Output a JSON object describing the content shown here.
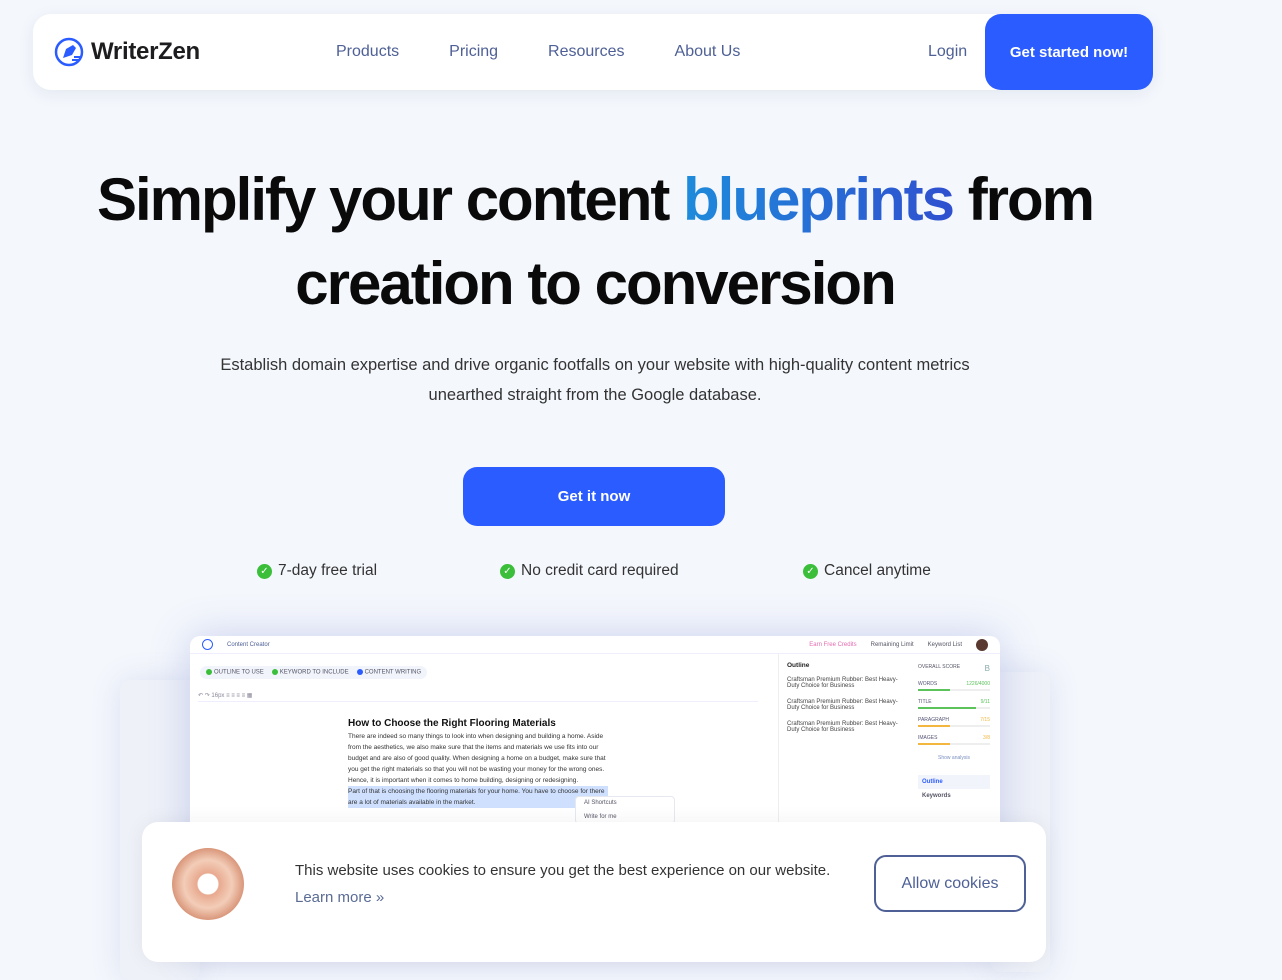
{
  "nav": {
    "brand": "WriterZen",
    "links": [
      "Products",
      "Pricing",
      "Resources",
      "About Us"
    ],
    "login": "Login",
    "cta": "Get started now!"
  },
  "hero": {
    "title_pre": "Simplify your content ",
    "title_accent": "blueprints",
    "title_post": " from",
    "title_line2": "creation to conversion",
    "subtitle_line1": "Establish domain expertise and drive organic footfalls on your website with high-quality content metrics",
    "subtitle_line2": "unearthed straight from the Google database.",
    "button": "Get it now",
    "checks": [
      "7-day free trial",
      "No credit card required",
      "Cancel anytime"
    ]
  },
  "mockup": {
    "app": "Content Creator",
    "credits": "Earn Free Credits",
    "limit": "Remaining Limit",
    "keyword_list": "Keyword List",
    "steps": [
      "OUTLINE TO USE",
      "KEYWORD TO INCLUDE",
      "CONTENT WRITING"
    ],
    "doc_title": "How to Choose the Right Flooring Materials",
    "doc_text": "There are indeed so many things to look into when designing and building a home. Aside from the aesthetics, we also make sure that the items and materials we use fits into our budget and are also of good quality. When designing a home on a budget, make sure that you get the right materials so that you will not be wasting your money for the wrong ones. Hence, it is important when it comes to home building, designing or redesigning.",
    "doc_highlight": "Part of that is choosing the flooring materials for your home. You have to choose for there are a lot of materials available in the market.",
    "ai_shortcuts": "AI Shortcuts",
    "write_for_me": "Write for me",
    "outline_title": "Outline",
    "outline_items": [
      "Craftsman Premium Rubber: Best Heavy-Duty Choice for Business",
      "Craftsman Premium Rubber: Best Heavy-Duty Choice for Business",
      "Craftsman Premium Rubber: Best Heavy-Duty Choice for Business"
    ],
    "score_title": "OVERALL SCORE",
    "grade": "B",
    "metrics": [
      {
        "label": "WORDS",
        "value": "1226/4000",
        "pct": 45,
        "color": "#5cc35c"
      },
      {
        "label": "TITLE",
        "value": "9/11",
        "pct": 80,
        "color": "#5cc35c"
      },
      {
        "label": "PARAGRAPH",
        "value": "7/15",
        "pct": 45,
        "color": "#f3b63f"
      },
      {
        "label": "IMAGES",
        "value": "3/8",
        "pct": 45,
        "color": "#f3b63f"
      }
    ],
    "show_analysis": "Show analysis",
    "tabs": [
      "Outline",
      "Keywords"
    ]
  },
  "cookie": {
    "text": "This website uses cookies to ensure you get the best experience on our website.",
    "learn_more": "Learn more »",
    "allow": "Allow cookies"
  }
}
